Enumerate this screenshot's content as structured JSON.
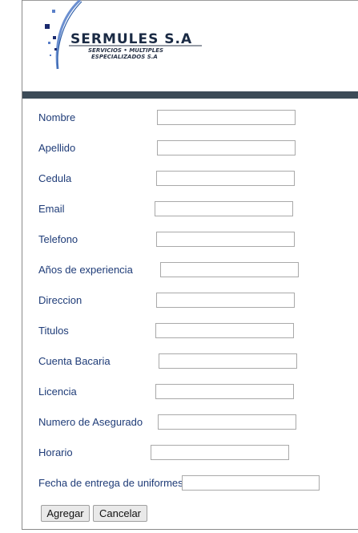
{
  "logo": {
    "name": "SERMULES S.A",
    "sub1": "SERVICIOS • MULTIPLES",
    "sub2": "ESPECIALIZADOS S.A"
  },
  "form": {
    "fields": [
      {
        "label": "Nombre",
        "value": ""
      },
      {
        "label": "Apellido",
        "value": ""
      },
      {
        "label": "Cedula",
        "value": ""
      },
      {
        "label": "Email",
        "value": ""
      },
      {
        "label": "Telefono",
        "value": ""
      },
      {
        "label": "Años de experiencia",
        "value": ""
      },
      {
        "label": "Direccion",
        "value": ""
      },
      {
        "label": "Titulos",
        "value": ""
      },
      {
        "label": "Cuenta Bacaria",
        "value": ""
      },
      {
        "label": "Licencia",
        "value": ""
      },
      {
        "label": "Numero de Asegurado",
        "value": ""
      },
      {
        "label": "Horario",
        "value": ""
      },
      {
        "label": "Fecha de entrega de uniformes",
        "value": ""
      }
    ],
    "submit_label": "Agregar",
    "cancel_label": "Cancelar"
  },
  "colors": {
    "label": "#1f3c78",
    "band": "#3c4b57",
    "logo_text": "#1a2a44",
    "logo_accent": "#2f5fa8"
  }
}
